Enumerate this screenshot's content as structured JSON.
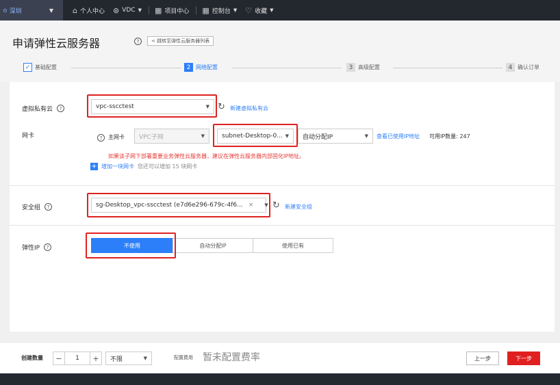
{
  "topbar": {
    "region": "深圳",
    "nav": [
      {
        "label": "个人中心",
        "icon": "home-icon"
      },
      {
        "label": "VDC",
        "icon": "vdc-icon"
      },
      {
        "label": "项目中心",
        "icon": "grid-icon"
      },
      {
        "label": "控制台",
        "icon": "console-icon"
      },
      {
        "label": "收藏",
        "icon": "heart-icon"
      }
    ]
  },
  "header": {
    "title": "申请弹性云服务器",
    "help": "?",
    "back_label": "< 跳转至弹性云服务器列表"
  },
  "steps": [
    {
      "num": "✓",
      "label": "基础配置"
    },
    {
      "num": "2",
      "label": "网络配置"
    },
    {
      "num": "3",
      "label": "高级配置"
    },
    {
      "num": "4",
      "label": "确认订单"
    }
  ],
  "vpc": {
    "label": "虚拟私有云",
    "value": "vpc-sscctest",
    "create_link": "新建虚拟私有云"
  },
  "nic": {
    "label": "网卡",
    "primary_label": "主网卡",
    "vpc_subnet_placeholder": "VPC子网",
    "subnet_value": "subnet-Desktop-0...",
    "ip_mode": "自动分配IP",
    "view_used_ip_link": "查看已使用IP地址",
    "available_ip_label": "可用IP数量:",
    "available_ip_count": "247",
    "warning": "如果该子网下部署重要业务弹性云服务器，建议在弹性云服务器内部固化IP地址。",
    "add_link": "增加一块网卡",
    "add_hint": "您还可以增加 15 块网卡"
  },
  "security_group": {
    "label": "安全组",
    "value": "sg-Desktop_vpc-sscctest (e7d6e296-679c-4f6...",
    "clear": "×",
    "create_link": "新建安全组"
  },
  "eip": {
    "label": "弹性IP",
    "options": [
      "不使用",
      "自动分配IP",
      "使用已有"
    ]
  },
  "footer": {
    "qty_label": "创建数量",
    "minus": "−",
    "qty": "1",
    "plus": "+",
    "limit": "不限",
    "fee_label": "配置费用",
    "fee_value": "暂未配置费率",
    "prev": "上一步",
    "next": "下一步"
  }
}
